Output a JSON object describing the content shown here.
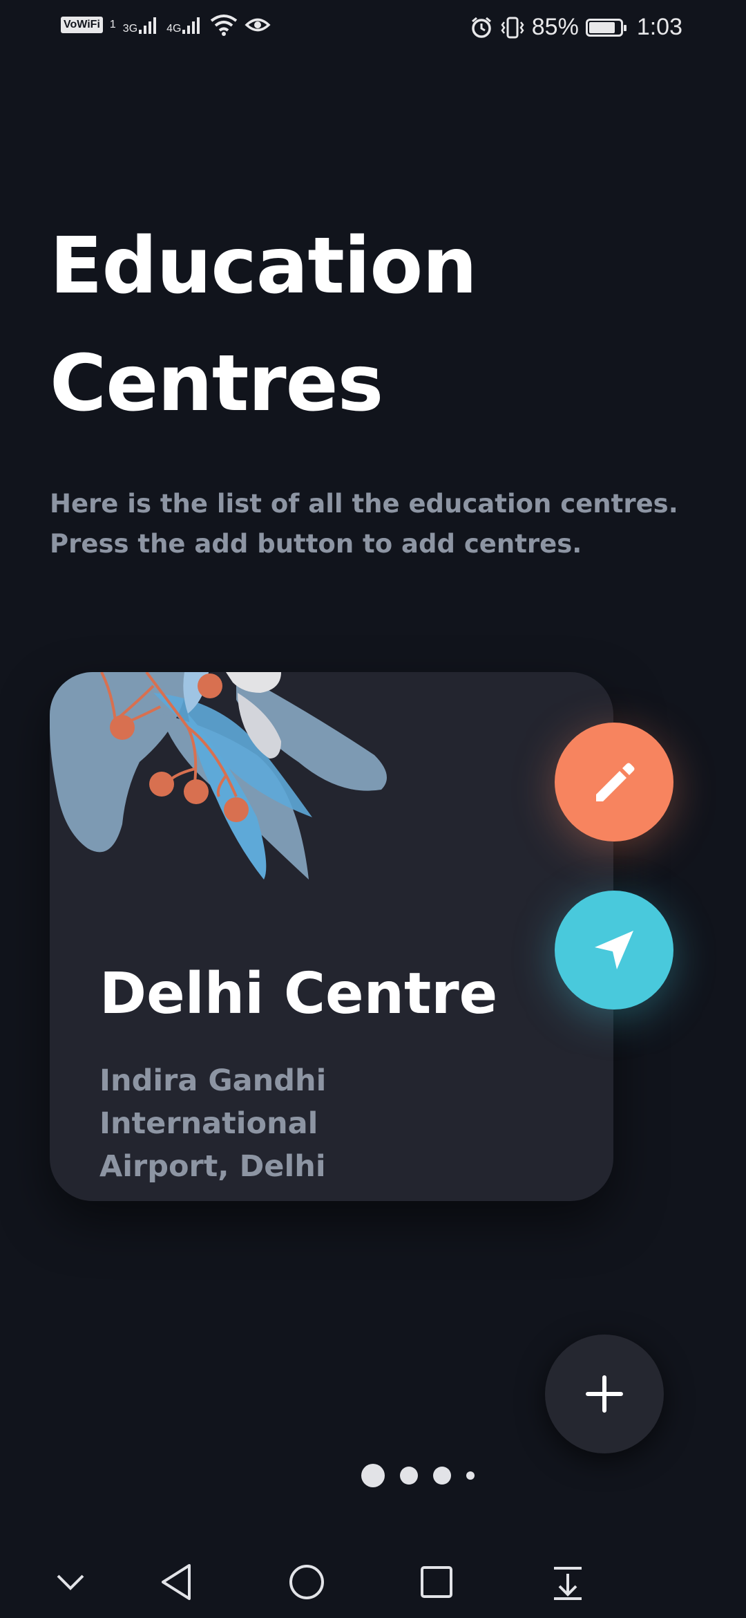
{
  "status_bar": {
    "vowifi": "VoWiFi",
    "sim_slot": "1",
    "net_3g": "3G",
    "net_4g": "4G",
    "battery_percent": "85%",
    "battery_level": 0.85,
    "time": "1:03",
    "icons": [
      "signal-3g-icon",
      "signal-4g-icon",
      "wifi-icon",
      "eye-comfort-icon",
      "alarm-icon",
      "vibrate-icon",
      "battery-icon"
    ]
  },
  "page": {
    "title_line1": "Education",
    "title_line2": "Centres",
    "subtitle_line1": "Here is the list of all the education centres.",
    "subtitle_line2": "Press the add button to add centres."
  },
  "centre_card": {
    "name": "Delhi Centre",
    "address_line1": "Indira Gandhi International",
    "address_line2": "Airport, Delhi"
  },
  "actions": {
    "edit_icon": "pencil-icon",
    "navigate_icon": "navigation-arrow-icon",
    "add_icon": "plus-icon"
  },
  "pager": {
    "count": 4,
    "active_index": 0
  },
  "system_nav": [
    "chevron-down-icon",
    "back-icon",
    "home-icon",
    "recents-icon",
    "notification-pull-icon"
  ],
  "colors": {
    "background": "#11141c",
    "card": "#23252f",
    "edit_accent": "#f7845f",
    "navigate_accent": "#49c9dc",
    "muted_text": "#8d95a3"
  }
}
